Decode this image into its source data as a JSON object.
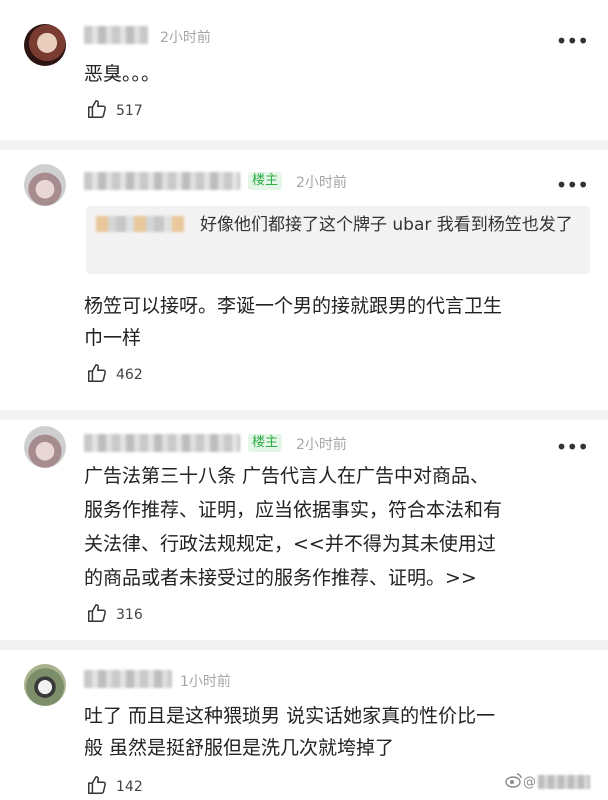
{
  "comments": [
    {
      "time": "2小时前",
      "text_lines": [
        "恶臭。。。"
      ],
      "likes": "517",
      "is_owner": false
    },
    {
      "owner_label": "楼主",
      "time": "2小时前",
      "quote_text": "好像他们都接了这个牌子 ubar 我看到杨笠也发了",
      "text_lines": [
        "杨笠可以接呀。李诞一个男的接就跟男的代言卫生",
        "巾一样"
      ],
      "likes": "462",
      "is_owner": true
    },
    {
      "owner_label": "楼主",
      "time": "2小时前",
      "text_lines": [
        "广告法第三十八条   广告代言人在广告中对商品、",
        "服务作推荐、证明，应当依据事实，符合本法和有",
        "关法律、行政法规规定，<<并不得为其未使用过",
        "的商品或者未接受过的服务作推荐、证明。>>"
      ],
      "likes": "316",
      "is_owner": true
    },
    {
      "time": "1小时前",
      "text_lines": [
        "吐了 而且是这种猥琐男 说实话她家真的性价比一",
        "般 虽然是挺舒服但是洗几次就垮掉了"
      ],
      "likes": "142",
      "is_owner": false
    }
  ],
  "more_icon": "more-dots-icon",
  "like_icon": "thumbs-up-icon",
  "colors": {
    "owner_badge_bg": "#e4f6e7",
    "owner_badge_text": "#2dae46",
    "time_text": "#a6a6a6",
    "quote_bg": "#f2f2f2"
  },
  "watermark": {
    "prefix": "@"
  }
}
